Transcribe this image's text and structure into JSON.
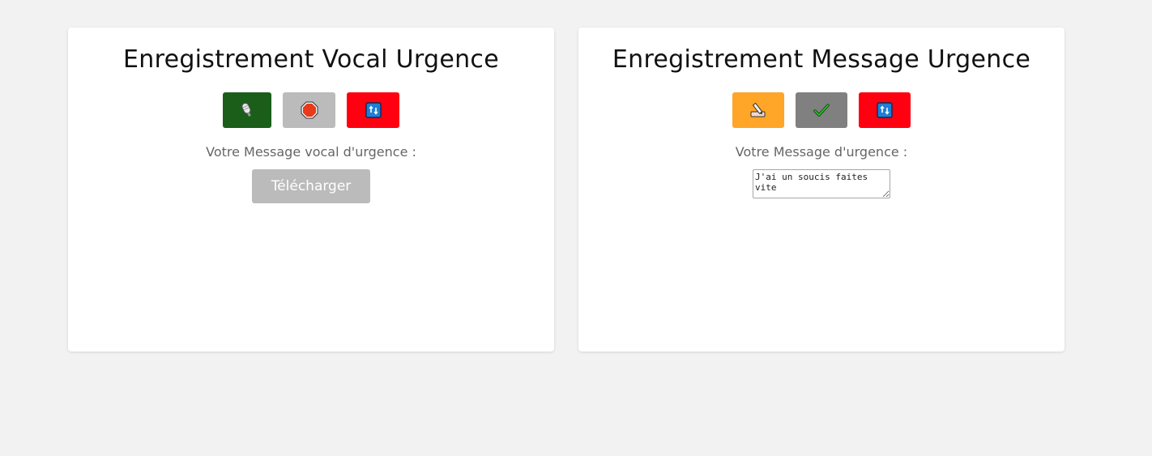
{
  "cards": {
    "vocal": {
      "title": "Enregistrement Vocal Urgence",
      "buttons": [
        {
          "icon": "microphone-icon",
          "color": "#1a5e1a"
        },
        {
          "icon": "stop-icon",
          "color": "#bbbbbb"
        },
        {
          "icon": "reset-icon",
          "color": "#ff0011"
        }
      ],
      "label": "Votre Message vocal d'urgence :",
      "download_label": "Télécharger"
    },
    "message": {
      "title": "Enregistrement Message Urgence",
      "buttons": [
        {
          "icon": "pencil-write-icon",
          "color": "#ffa528"
        },
        {
          "icon": "checkmark-icon",
          "color": "#808080"
        },
        {
          "icon": "reset-icon",
          "color": "#ff0011"
        }
      ],
      "label": "Votre Message d'urgence :",
      "message_value": "J'ai un soucis faites vite"
    }
  },
  "colors": {
    "background": "#f2f2f2",
    "card": "#ffffff"
  }
}
